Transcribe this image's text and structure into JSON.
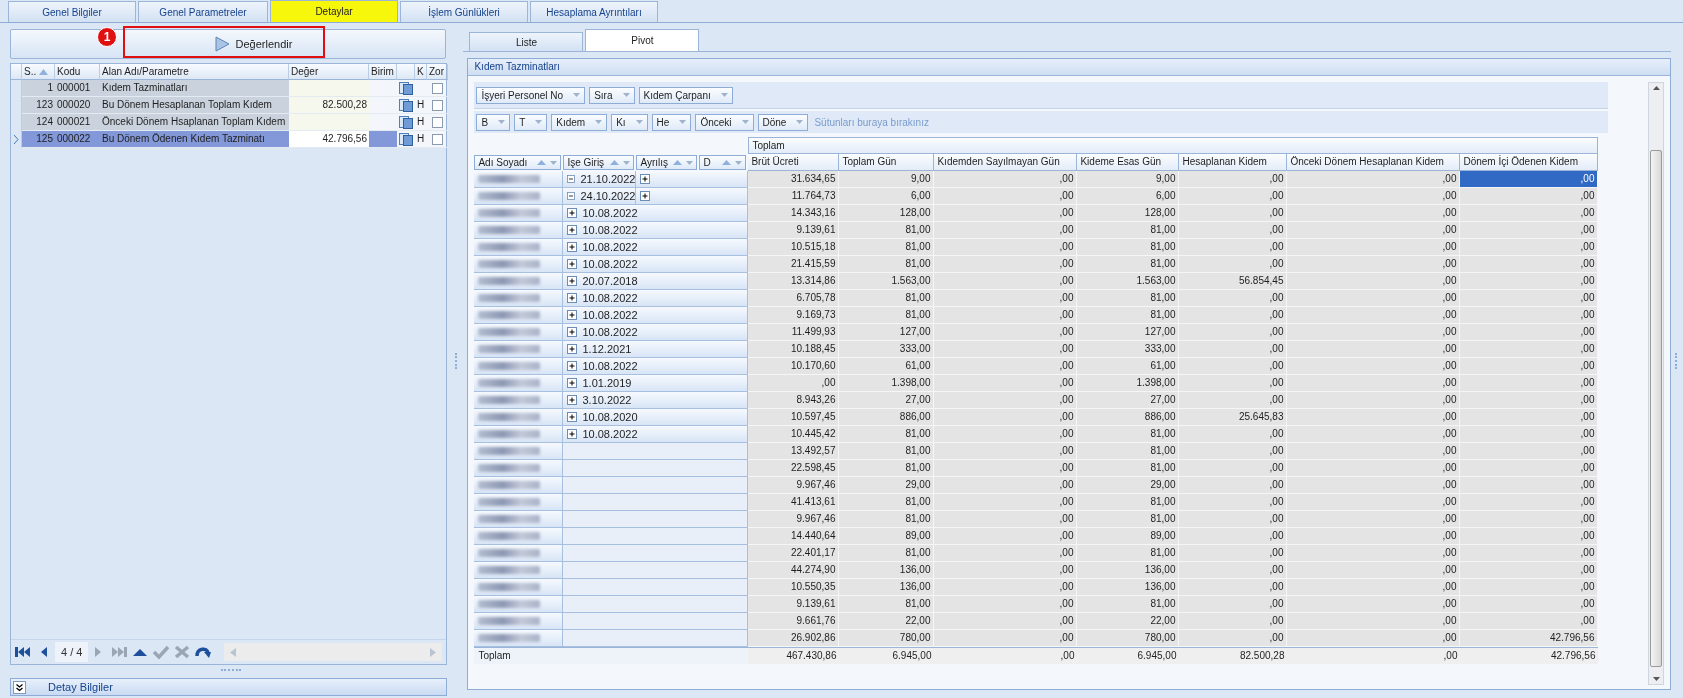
{
  "tabs": [
    {
      "label": "Genel Bilgiler",
      "selected": false
    },
    {
      "label": "Genel Parametreler",
      "selected": false
    },
    {
      "label": "Detaylar",
      "selected": true
    },
    {
      "label": "İşlem Günlükleri",
      "selected": false
    },
    {
      "label": "Hesaplama Ayrıntıları",
      "selected": false
    }
  ],
  "left_panel": {
    "evaluate_button": {
      "label": "Değerlendir"
    },
    "annotation": {
      "number": "1"
    },
    "grid": {
      "columns": [
        "S..",
        "Kodu",
        "Alan Adı/Parametre",
        "Değer",
        "Birim",
        "K",
        "Zor"
      ],
      "rows": [
        {
          "sira": "1",
          "kodu": "000001",
          "name": "Kıdem Tazminatları",
          "checked": false,
          "selected": false
        },
        {
          "sira": "123",
          "kodu": "000020",
          "name": "Bu Dönem Hesaplanan Toplam Kıdem",
          "value": "82.500,28",
          "flag": "H",
          "checked": false,
          "selected": false
        },
        {
          "sira": "124",
          "kodu": "000021",
          "name": "Önceki Dönem Hsaplanan Toplam Kıdem",
          "flag": "H",
          "checked": false,
          "selected": false
        },
        {
          "sira": "125",
          "kodu": "000022",
          "name": "Bu Dönem Ödenen Kıdem Tazminatı",
          "value": "42.796,56",
          "flag": "H",
          "checked": false,
          "selected": true
        }
      ]
    },
    "navigator": {
      "position": "4 / 4",
      "buttons": [
        {
          "kind": "first",
          "disabled": false
        },
        {
          "kind": "prev",
          "disabled": false
        },
        {
          "kind": "next",
          "disabled": true
        },
        {
          "kind": "last",
          "disabled": true
        },
        {
          "kind": "append",
          "disabled": false
        },
        {
          "kind": "save",
          "disabled": true
        },
        {
          "kind": "cancel",
          "disabled": true
        },
        {
          "kind": "refresh",
          "disabled": false
        }
      ]
    }
  },
  "detail_bar": {
    "label": "Detay Bilgiler"
  },
  "right_panel": {
    "subtabs": [
      {
        "label": "Liste",
        "selected": false
      },
      {
        "label": "Pivot",
        "selected": true
      }
    ],
    "group_title": "Kıdem Tazminatları",
    "pivot": {
      "filter_fields": [
        "İşyeri Personel No",
        "Sıra",
        "Kıdem Çarpanı"
      ],
      "data_fields": [
        "B",
        "T",
        "Kıdem",
        "Kı",
        "He",
        "Önceki",
        "Döne"
      ],
      "drop_hint": "Sütunları buraya bırakınız",
      "row_fields": [
        "Adı Soyadı",
        "İşe Giriş",
        "Ayrılış",
        "D"
      ],
      "column_group": "Toplam",
      "columns": [
        "Brüt Ücreti",
        "Toplam Gün",
        "Kıdemden Sayılmayan Gün",
        "Kideme Esas Gün",
        "Hesaplanan Kidem",
        "Önceki Dönem Hesaplanan Kidem",
        "Dönem İçi Ödenen Kidem"
      ],
      "rows": [
        {
          "ise_giris": "21.10.2022",
          "expanded": true,
          "selected": true,
          "values": [
            "31.634,65",
            "9,00",
            ",00",
            "9,00",
            ",00",
            ",00",
            ",00"
          ]
        },
        {
          "ise_giris": "24.10.2022",
          "expanded": true,
          "selected": false,
          "values": [
            "11.764,73",
            "6,00",
            ",00",
            "6,00",
            ",00",
            ",00",
            ",00"
          ]
        },
        {
          "ise_giris": "10.08.2022",
          "expanded": false,
          "selected": false,
          "values": [
            "14.343,16",
            "128,00",
            ",00",
            "128,00",
            ",00",
            ",00",
            ",00"
          ]
        },
        {
          "ise_giris": "10.08.2022",
          "expanded": false,
          "selected": false,
          "values": [
            "9.139,61",
            "81,00",
            ",00",
            "81,00",
            ",00",
            ",00",
            ",00"
          ]
        },
        {
          "ise_giris": "10.08.2022",
          "expanded": false,
          "selected": false,
          "values": [
            "10.515,18",
            "81,00",
            ",00",
            "81,00",
            ",00",
            ",00",
            ",00"
          ]
        },
        {
          "ise_giris": "10.08.2022",
          "expanded": false,
          "selected": false,
          "values": [
            "21.415,59",
            "81,00",
            ",00",
            "81,00",
            ",00",
            ",00",
            ",00"
          ]
        },
        {
          "ise_giris": "20.07.2018",
          "expanded": false,
          "selected": false,
          "values": [
            "13.314,86",
            "1.563,00",
            ",00",
            "1.563,00",
            "56.854,45",
            ",00",
            ",00"
          ]
        },
        {
          "ise_giris": "10.08.2022",
          "expanded": false,
          "selected": false,
          "values": [
            "6.705,78",
            "81,00",
            ",00",
            "81,00",
            ",00",
            ",00",
            ",00"
          ]
        },
        {
          "ise_giris": "10.08.2022",
          "expanded": false,
          "selected": false,
          "values": [
            "9.169,73",
            "81,00",
            ",00",
            "81,00",
            ",00",
            ",00",
            ",00"
          ]
        },
        {
          "ise_giris": "10.08.2022",
          "expanded": false,
          "selected": false,
          "values": [
            "11.499,93",
            "127,00",
            ",00",
            "127,00",
            ",00",
            ",00",
            ",00"
          ]
        },
        {
          "ise_giris": "1.12.2021",
          "expanded": false,
          "selected": false,
          "values": [
            "10.188,45",
            "333,00",
            ",00",
            "333,00",
            ",00",
            ",00",
            ",00"
          ]
        },
        {
          "ise_giris": "10.08.2022",
          "expanded": false,
          "selected": false,
          "values": [
            "10.170,60",
            "61,00",
            ",00",
            "61,00",
            ",00",
            ",00",
            ",00"
          ]
        },
        {
          "ise_giris": "1.01.2019",
          "expanded": false,
          "selected": false,
          "values": [
            ",00",
            "1.398,00",
            ",00",
            "1.398,00",
            ",00",
            ",00",
            ",00"
          ]
        },
        {
          "ise_giris": "3.10.2022",
          "expanded": false,
          "selected": false,
          "values": [
            "8.943,26",
            "27,00",
            ",00",
            "27,00",
            ",00",
            ",00",
            ",00"
          ]
        },
        {
          "ise_giris": "10.08.2020",
          "expanded": false,
          "selected": false,
          "values": [
            "10.597,45",
            "886,00",
            ",00",
            "886,00",
            "25.645,83",
            ",00",
            ",00"
          ]
        },
        {
          "ise_giris": "10.08.2022",
          "expanded": false,
          "selected": false,
          "values": [
            "10.445,42",
            "81,00",
            ",00",
            "81,00",
            ",00",
            ",00",
            ",00"
          ]
        },
        {
          "selected": false,
          "values": [
            "13.492,57",
            "81,00",
            ",00",
            "81,00",
            ",00",
            ",00",
            ",00"
          ]
        },
        {
          "selected": false,
          "values": [
            "22.598,45",
            "81,00",
            ",00",
            "81,00",
            ",00",
            ",00",
            ",00"
          ]
        },
        {
          "selected": false,
          "values": [
            "9.967,46",
            "29,00",
            ",00",
            "29,00",
            ",00",
            ",00",
            ",00"
          ]
        },
        {
          "selected": false,
          "values": [
            "41.413,61",
            "81,00",
            ",00",
            "81,00",
            ",00",
            ",00",
            ",00"
          ]
        },
        {
          "selected": false,
          "values": [
            "9.967,46",
            "81,00",
            ",00",
            "81,00",
            ",00",
            ",00",
            ",00"
          ]
        },
        {
          "selected": false,
          "values": [
            "14.440,64",
            "89,00",
            ",00",
            "89,00",
            ",00",
            ",00",
            ",00"
          ]
        },
        {
          "selected": false,
          "values": [
            "22.401,17",
            "81,00",
            ",00",
            "81,00",
            ",00",
            ",00",
            ",00"
          ]
        },
        {
          "selected": false,
          "values": [
            "44.274,90",
            "136,00",
            ",00",
            "136,00",
            ",00",
            ",00",
            ",00"
          ]
        },
        {
          "selected": false,
          "values": [
            "10.550,35",
            "136,00",
            ",00",
            "136,00",
            ",00",
            ",00",
            ",00"
          ]
        },
        {
          "selected": false,
          "values": [
            "9.139,61",
            "81,00",
            ",00",
            "81,00",
            ",00",
            ",00",
            ",00"
          ]
        },
        {
          "selected": false,
          "values": [
            "9.661,76",
            "22,00",
            ",00",
            "22,00",
            ",00",
            ",00",
            ",00"
          ]
        },
        {
          "selected": false,
          "values": [
            "26.902,86",
            "780,00",
            ",00",
            "780,00",
            ",00",
            ",00",
            "42.796,56"
          ]
        }
      ],
      "total": {
        "label": "Toplam",
        "values": [
          "467.430,86",
          "6.945,00",
          ",00",
          "6.945,00",
          "82.500,28",
          ",00",
          "42.796,56"
        ]
      }
    }
  }
}
